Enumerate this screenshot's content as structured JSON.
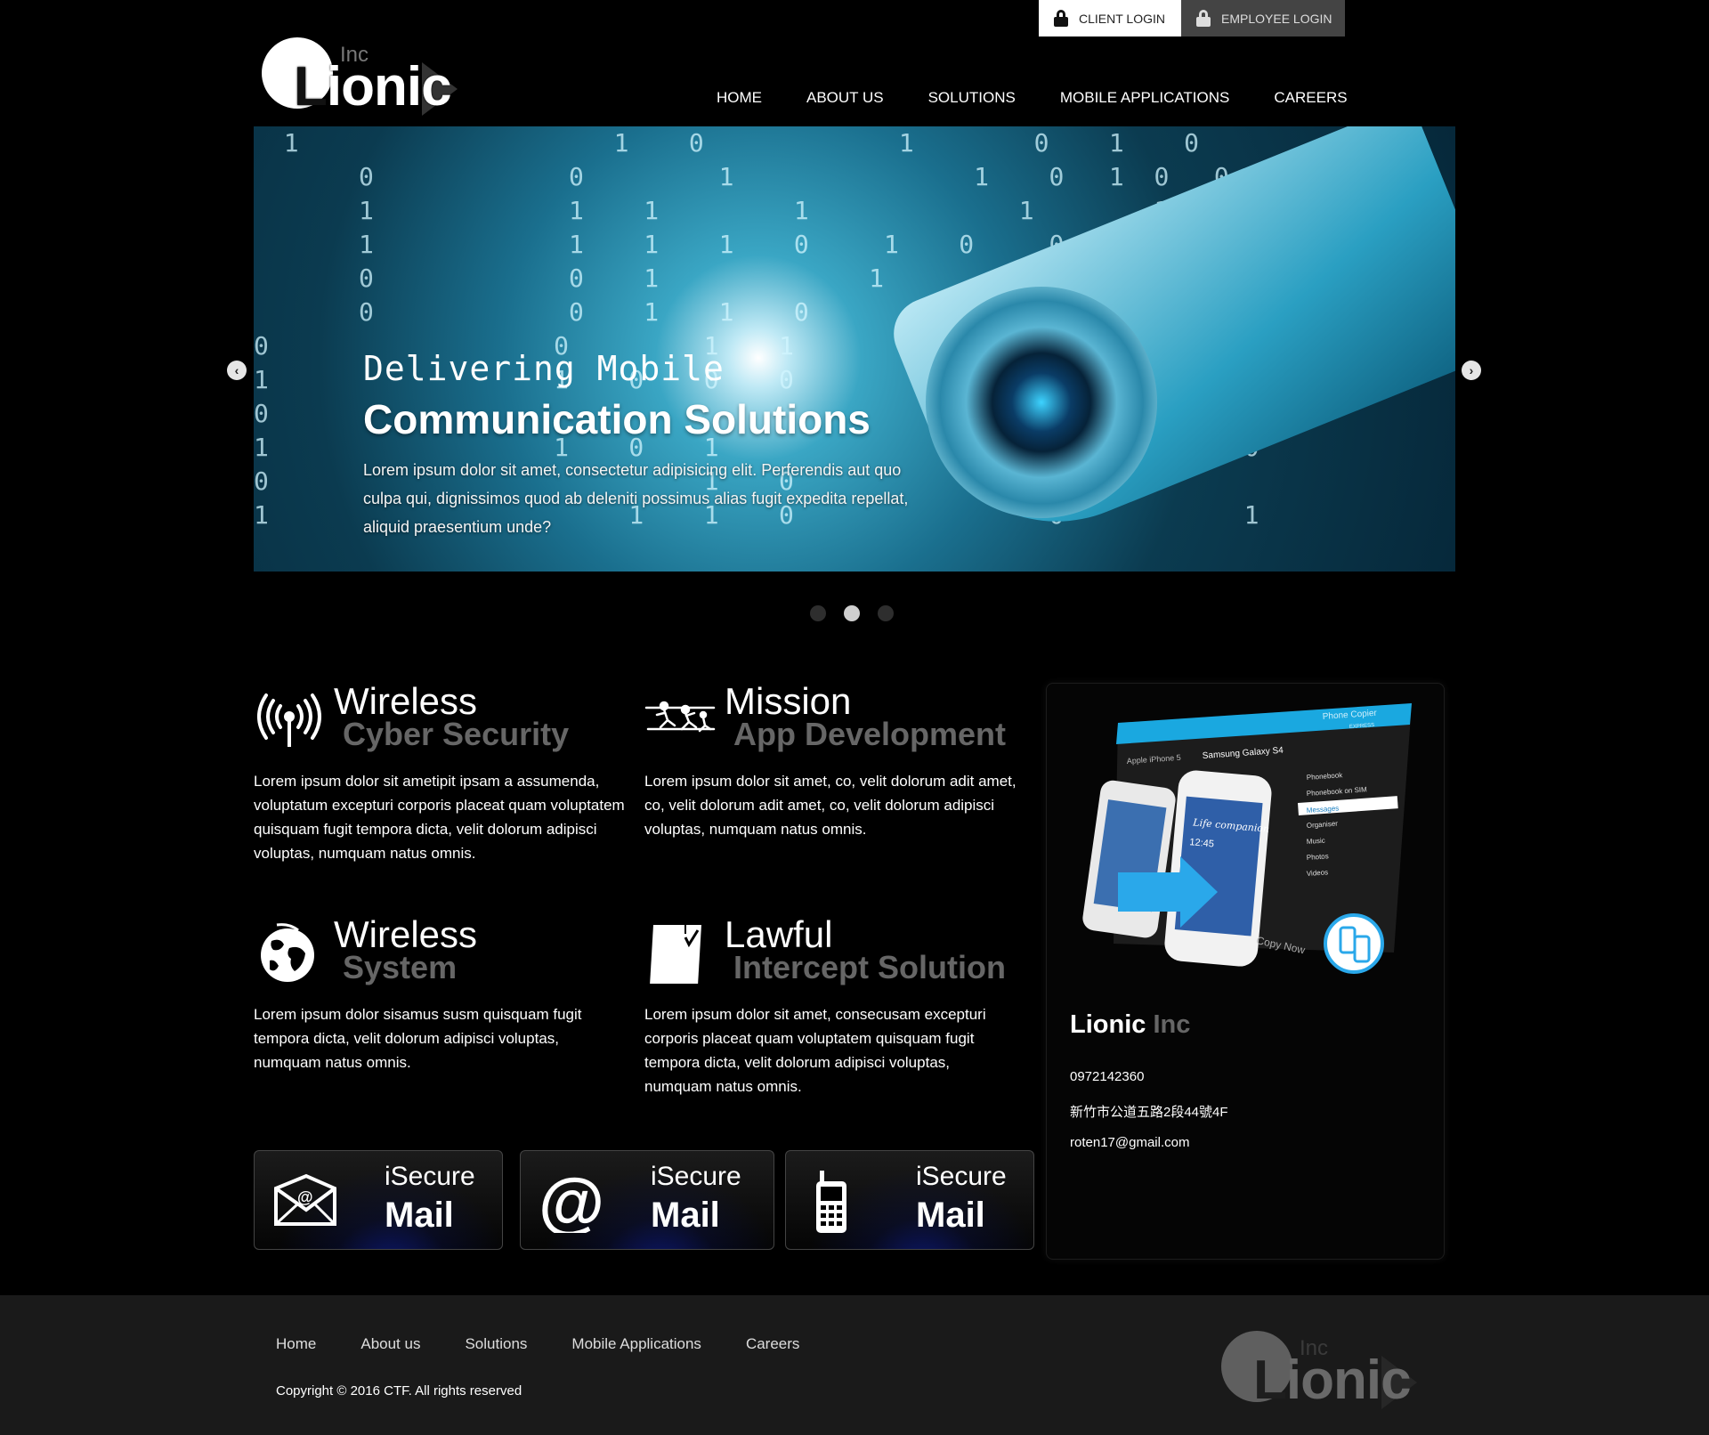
{
  "login": {
    "client": "CLIENT LOGIN",
    "employee": "EMPLOYEE LOGIN"
  },
  "logo": {
    "inc": "Inc",
    "l": "L",
    "rest": "ionic"
  },
  "nav": [
    "HOME",
    "ABOUT US",
    "SOLUTIONS",
    "MOBILE APPLICATIONS",
    "CAREERS"
  ],
  "carousel": {
    "line1": "Delivering Mobile",
    "line2": "Communication Solutions",
    "text": "Lorem ipsum dolor sit amet, consectetur adipisicing elit. Perferendis aut quo culpa qui, dignissimos quod ab deleniti possimus alias fugit expedita repellat, aliquid praesentium unde?",
    "prev": "‹",
    "next": "›",
    "slides": 3,
    "active_slide": 2
  },
  "features": [
    {
      "title": "Wireless",
      "subtitle": "Cyber Security",
      "icon": "wireless-antenna-icon",
      "text": "Lorem ipsum dolor sit ametipit ipsam a assumenda, voluptatum excepturi corporis placeat quam voluptatem quisquam fugit tempora dicta, velit dolorum adipisci voluptas, numquam natus omnis."
    },
    {
      "title": "Mission",
      "subtitle": "App Development",
      "icon": "running-figures-icon",
      "text": "Lorem ipsum dolor sit amet, co, velit dolorum adit amet, co, velit dolorum adit amet, co, velit dolorum adipisci voluptas, numquam natus omnis."
    },
    {
      "title": "Wireless",
      "subtitle": "System",
      "icon": "globe-icon",
      "text": "Lorem ipsum dolor sisamus susm quisquam fugit tempora dicta, velit dolorum adipisci voluptas, numquam natus omnis."
    },
    {
      "title": "Lawful",
      "subtitle": "Intercept Solution",
      "icon": "document-check-icon",
      "text": "Lorem ipsum dolor sit amet, consecusam excepturi corporis placeat quam voluptatem quisquam fugit tempora dicta, velit dolorum adipisci voluptas, numquam natus omnis."
    }
  ],
  "side": {
    "brand": "Lionic",
    "brand_inc": "Inc",
    "phone": "0972142360",
    "address": "新竹市公道五路2段44號4F",
    "email": "roten17@gmail.com",
    "art": {
      "app_name": "Phone Copier",
      "app_edition": "EXPRESS",
      "copy_from": "Apple iPhone 5",
      "copy_to": "Samsung Galaxy S4",
      "menu": [
        "Phonebook",
        "Phonebook on SIM",
        "Messages",
        "Organiser",
        "Music",
        "Photos",
        "Videos"
      ],
      "selected": "Messages",
      "copy_now": "Copy Now",
      "clock": "12:45",
      "wallpaper": "Life companion"
    }
  },
  "tiles": [
    {
      "line1": "iSecure",
      "line2": "Mail",
      "icon": "envelope-icon"
    },
    {
      "line1": "iSecure",
      "line2": "Mail",
      "icon": "at-sign-icon"
    },
    {
      "line1": "iSecure",
      "line2": "Mail",
      "icon": "mobile-phone-icon"
    }
  ],
  "footer": {
    "nav": [
      "Home",
      "About us",
      "Solutions",
      "Mobile Applications",
      "Careers"
    ],
    "copyright": "Copyright © 2016 CTF. All rights reserved"
  }
}
